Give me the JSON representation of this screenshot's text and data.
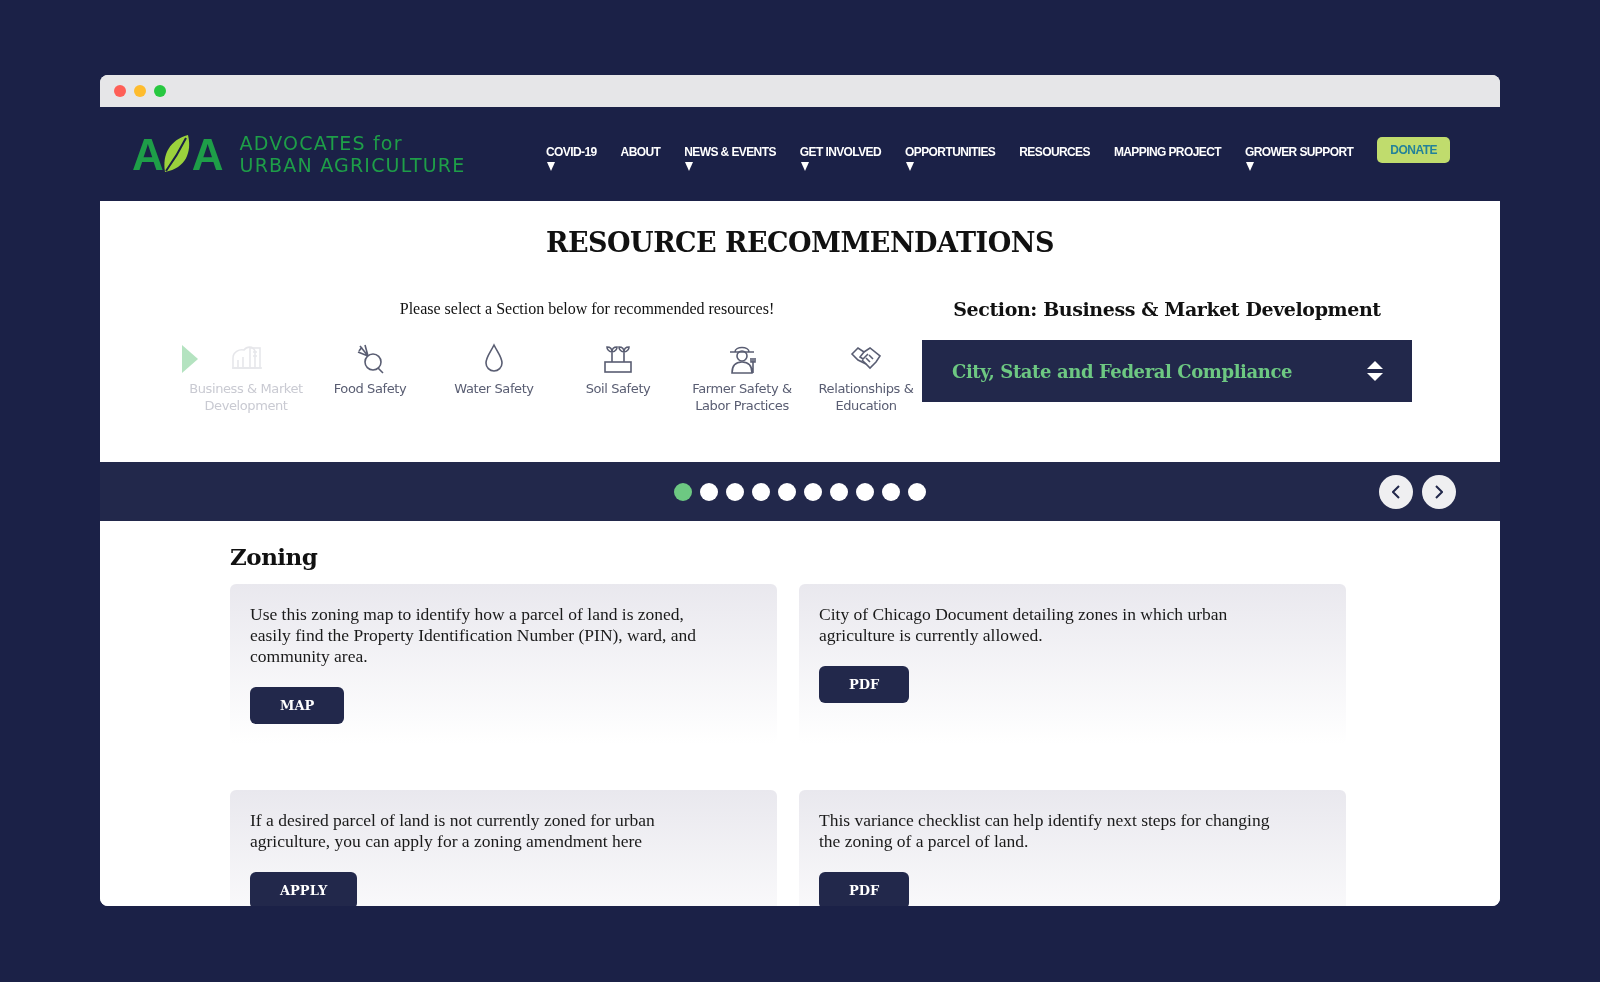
{
  "logo": {
    "mark_left": "A",
    "mark_right": "A",
    "name_line1": "ADVOCATES for",
    "name_line2": "URBAN AGRICULTURE"
  },
  "nav": [
    {
      "label": "COVID-19",
      "has_dropdown": true
    },
    {
      "label": "ABOUT",
      "has_dropdown": false
    },
    {
      "label": "NEWS & EVENTS",
      "has_dropdown": true
    },
    {
      "label": "GET INVOLVED",
      "has_dropdown": true
    },
    {
      "label": "OPPORTUNITIES",
      "has_dropdown": true
    },
    {
      "label": "RESOURCES",
      "has_dropdown": false
    },
    {
      "label": "MAPPING PROJECT",
      "has_dropdown": false
    },
    {
      "label": "GROWER SUPPORT",
      "has_dropdown": true
    }
  ],
  "donate_button": "DONATE",
  "page_title": "RESOURCE RECOMMENDATIONS",
  "instruction": "Please select a Section below for recommended resources!",
  "sections": [
    {
      "kind": "buildings",
      "label": "Business & Market Development",
      "selected": true
    },
    {
      "kind": "beet",
      "label": "Food Safety",
      "selected": false
    },
    {
      "kind": "drop",
      "label": "Water Safety",
      "selected": false
    },
    {
      "kind": "sprouts",
      "label": "Soil Safety",
      "selected": false
    },
    {
      "kind": "farmer",
      "label": "Farmer Safety & Labor Practices",
      "selected": false
    },
    {
      "kind": "handshake",
      "label": "Relationships & Education",
      "selected": false
    }
  ],
  "section_heading": "Section: Business & Market Development",
  "topic_select": {
    "value": "City, State and Federal Compliance"
  },
  "slides": [
    {
      "selected": true
    },
    {
      "selected": false
    },
    {
      "selected": false
    },
    {
      "selected": false
    },
    {
      "selected": false
    },
    {
      "selected": false
    },
    {
      "selected": false
    },
    {
      "selected": false
    },
    {
      "selected": false
    },
    {
      "selected": false
    }
  ],
  "topic_heading": "Zoning",
  "cards": [
    {
      "text": "Use this zoning map to identify how a parcel of land is zoned, easily find the Property Identification Number (PIN), ward, and community area.",
      "button": "MAP"
    },
    {
      "text": "City of Chicago Document detailing zones in which urban agriculture is currently allowed.",
      "button": "PDF"
    },
    {
      "text": "If a desired parcel of land is not currently zoned for urban agriculture, you can apply for a zoning amendment here",
      "button": "APPLY"
    },
    {
      "text": "This variance checklist can help identify next steps for changing the zoning of a parcel of land.",
      "button": "PDF"
    }
  ]
}
